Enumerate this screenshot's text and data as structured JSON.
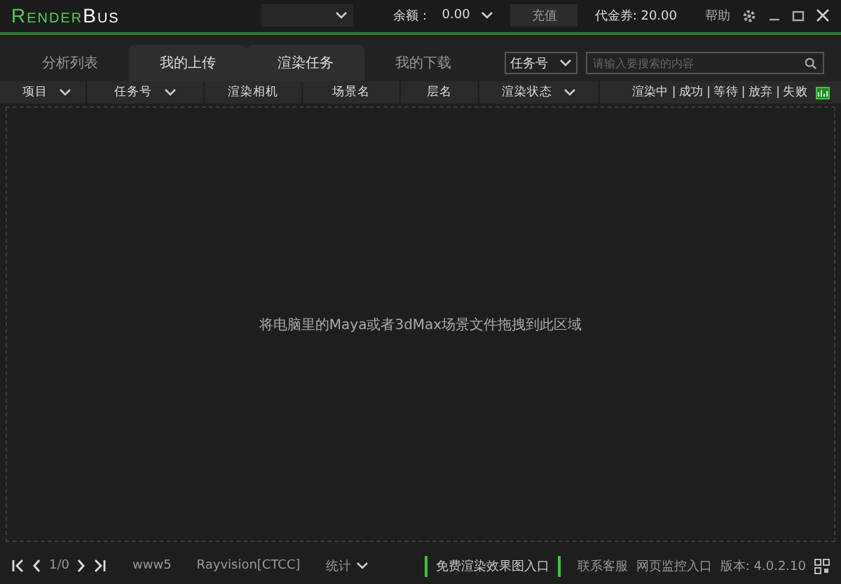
{
  "title_bar": {
    "logo_left": "Render",
    "logo_right": "Bus",
    "balance_label": "余额：",
    "balance": "0.00",
    "recharge": "充值",
    "voucher": "代金券: 20.00",
    "help": "帮助"
  },
  "tabs": [
    {
      "label": "分析列表",
      "selected": false
    },
    {
      "label": "我的上传",
      "selected": true
    },
    {
      "label": "渲染任务",
      "selected": true
    },
    {
      "label": "我的下载",
      "selected": false
    }
  ],
  "search": {
    "filter": "任务号",
    "placeholder": "请输入要搜索的内容"
  },
  "columns": [
    {
      "label": "项目",
      "dropdown": true
    },
    {
      "label": "任务号",
      "dropdown": true
    },
    {
      "label": "渲染相机",
      "dropdown": false
    },
    {
      "label": "场景名",
      "dropdown": false
    },
    {
      "label": "层名",
      "dropdown": false
    },
    {
      "label": "渲染状态",
      "dropdown": true
    },
    {
      "label": "渲染中 | 成功 | 等待 | 放弃 | 失败",
      "dropdown": false
    }
  ],
  "drop_hint": "将电脑里的Maya或者3dMax场景文件拖拽到此区域",
  "status_bar": {
    "page": "1/0",
    "server": "www5",
    "line": "Rayvision[CTCC]",
    "stats": "统计",
    "free_link": "免费渲染效果图入口",
    "contact": "联系客服",
    "monitor": "网页监控入口",
    "version": "版本: 4.0.2.10"
  }
}
